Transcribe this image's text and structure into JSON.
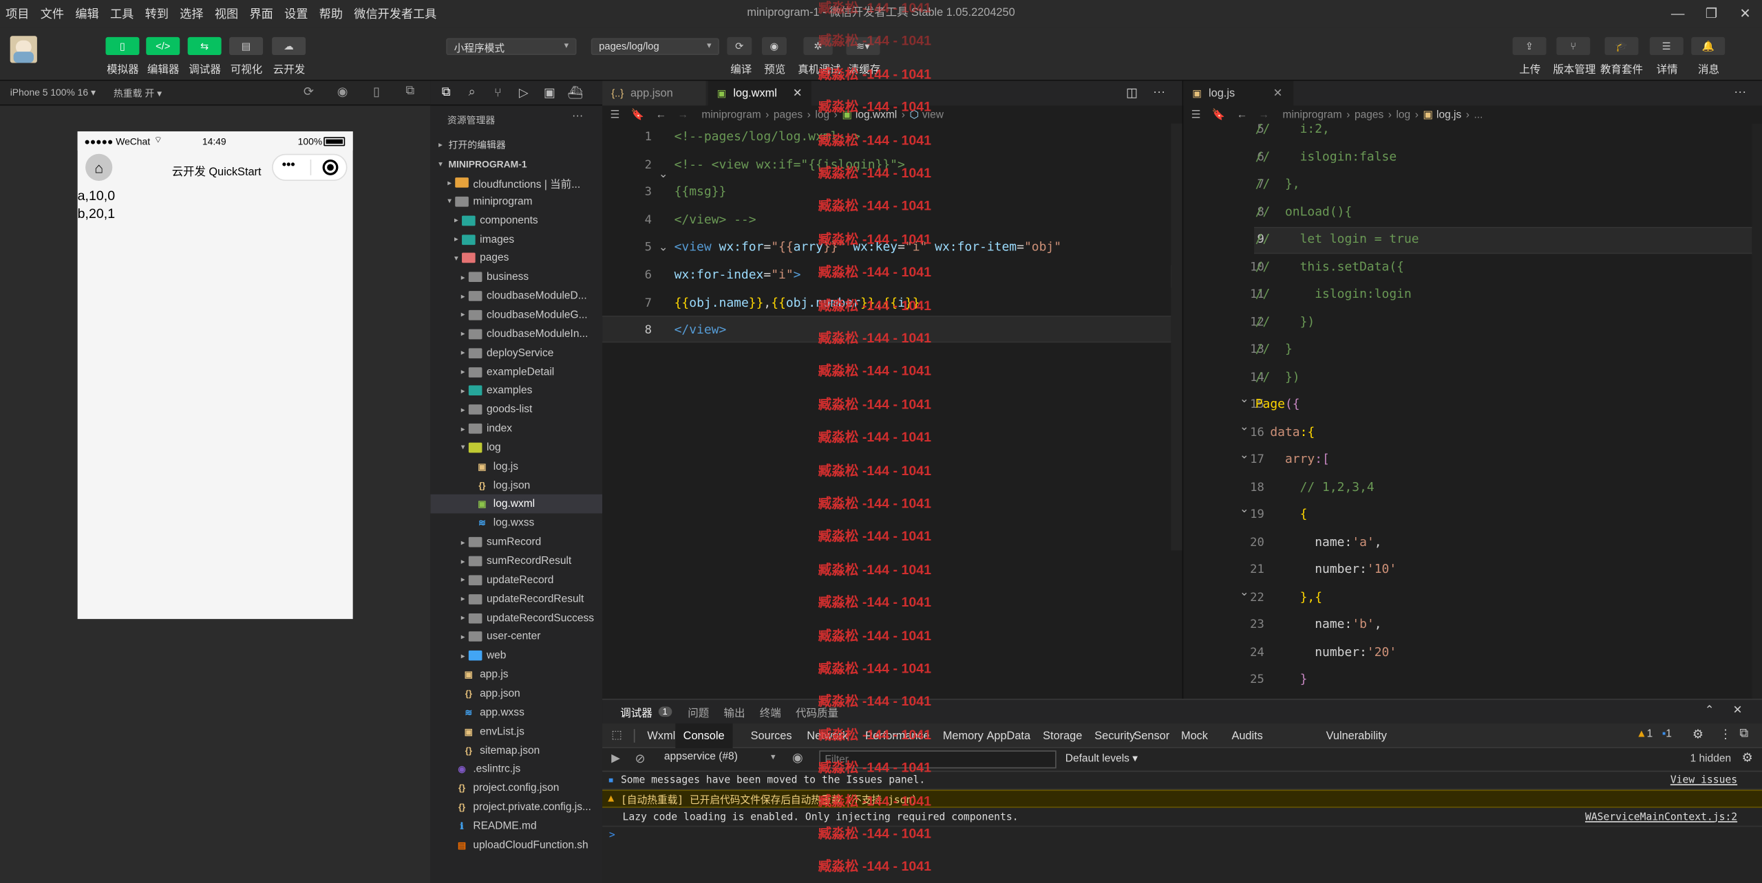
{
  "menu": {
    "items": [
      "项目",
      "文件",
      "编辑",
      "工具",
      "转到",
      "选择",
      "视图",
      "界面",
      "设置",
      "帮助",
      "微信开发者工具"
    ],
    "title": "miniprogram-1 - 微信开发者工具 Stable 1.05.2204250"
  },
  "toolbar": {
    "left_buttons": [
      "模拟器",
      "编辑器",
      "调试器",
      "可视化",
      "云开发"
    ],
    "mode_select": "小程序模式",
    "page_select": "pages/log/log",
    "center_buttons": [
      "编译",
      "预览",
      "真机调试",
      "清缓存"
    ],
    "right_buttons": [
      "上传",
      "版本管理",
      "教育套件",
      "详情",
      "消息"
    ]
  },
  "devicebar": {
    "device": "iPhone 5 100% 16 ▾",
    "hotreload": "热重载 开 ▾"
  },
  "phone": {
    "signal": "●●●●● WeChat",
    "time": "14:49",
    "battery": "100%",
    "nav_title": "云开发 QuickStart",
    "lines": [
      "a,10,0",
      "b,20,1"
    ]
  },
  "explorer": {
    "header": "资源管理器",
    "open_editors": "打开的编辑器",
    "project": "MINIPROGRAM-1",
    "tree": [
      {
        "label": "cloudfunctions | 当前...",
        "depth": 1,
        "kind": "folder-cloud",
        "twisty": "▸"
      },
      {
        "label": "miniprogram",
        "depth": 1,
        "kind": "folder",
        "twisty": "▾"
      },
      {
        "label": "components",
        "depth": 2,
        "kind": "folder-teal",
        "twisty": "▸"
      },
      {
        "label": "images",
        "depth": 2,
        "kind": "folder-teal",
        "twisty": "▸"
      },
      {
        "label": "pages",
        "depth": 2,
        "kind": "folder-red",
        "twisty": "▾"
      },
      {
        "label": "business",
        "depth": 3,
        "kind": "folder",
        "twisty": "▸"
      },
      {
        "label": "cloudbaseModuleD...",
        "depth": 3,
        "kind": "folder",
        "twisty": "▸"
      },
      {
        "label": "cloudbaseModuleG...",
        "depth": 3,
        "kind": "folder",
        "twisty": "▸"
      },
      {
        "label": "cloudbaseModuleIn...",
        "depth": 3,
        "kind": "folder",
        "twisty": "▸"
      },
      {
        "label": "deployService",
        "depth": 3,
        "kind": "folder",
        "twisty": "▸"
      },
      {
        "label": "exampleDetail",
        "depth": 3,
        "kind": "folder",
        "twisty": "▸"
      },
      {
        "label": "examples",
        "depth": 3,
        "kind": "folder-teal",
        "twisty": "▸"
      },
      {
        "label": "goods-list",
        "depth": 3,
        "kind": "folder",
        "twisty": "▸"
      },
      {
        "label": "index",
        "depth": 3,
        "kind": "folder",
        "twisty": "▸"
      },
      {
        "label": "log",
        "depth": 3,
        "kind": "folder-open",
        "twisty": "▾"
      },
      {
        "label": "log.js",
        "depth": 4,
        "kind": "js",
        "twisty": ""
      },
      {
        "label": "log.json",
        "depth": 4,
        "kind": "json",
        "twisty": ""
      },
      {
        "label": "log.wxml",
        "depth": 4,
        "kind": "wxml",
        "twisty": "",
        "selected": true
      },
      {
        "label": "log.wxss",
        "depth": 4,
        "kind": "wxss",
        "twisty": ""
      },
      {
        "label": "sumRecord",
        "depth": 3,
        "kind": "folder",
        "twisty": "▸"
      },
      {
        "label": "sumRecordResult",
        "depth": 3,
        "kind": "folder",
        "twisty": "▸"
      },
      {
        "label": "updateRecord",
        "depth": 3,
        "kind": "folder",
        "twisty": "▸"
      },
      {
        "label": "updateRecordResult",
        "depth": 3,
        "kind": "folder",
        "twisty": "▸"
      },
      {
        "label": "updateRecordSuccess",
        "depth": 3,
        "kind": "folder",
        "twisty": "▸"
      },
      {
        "label": "user-center",
        "depth": 3,
        "kind": "folder",
        "twisty": "▸"
      },
      {
        "label": "web",
        "depth": 3,
        "kind": "folder-blue",
        "twisty": "▸"
      },
      {
        "label": "app.js",
        "depth": 2,
        "kind": "js",
        "twisty": ""
      },
      {
        "label": "app.json",
        "depth": 2,
        "kind": "json",
        "twisty": ""
      },
      {
        "label": "app.wxss",
        "depth": 2,
        "kind": "wxss",
        "twisty": ""
      },
      {
        "label": "envList.js",
        "depth": 2,
        "kind": "js",
        "twisty": ""
      },
      {
        "label": "sitemap.json",
        "depth": 2,
        "kind": "json",
        "twisty": ""
      },
      {
        "label": ".eslintrc.js",
        "depth": 1,
        "kind": "eslint",
        "twisty": ""
      },
      {
        "label": "project.config.json",
        "depth": 1,
        "kind": "json",
        "twisty": ""
      },
      {
        "label": "project.private.config.js...",
        "depth": 1,
        "kind": "json",
        "twisty": ""
      },
      {
        "label": "README.md",
        "depth": 1,
        "kind": "info",
        "twisty": ""
      },
      {
        "label": "uploadCloudFunction.sh",
        "depth": 1,
        "kind": "sh",
        "twisty": ""
      }
    ]
  },
  "editor1": {
    "tabs": [
      "app.json",
      "log.wxml"
    ],
    "breadcrumb": [
      "miniprogram",
      "pages",
      "log",
      "log.wxml",
      "view"
    ],
    "line_numbers": [
      "1",
      "2",
      "3",
      "4",
      "5",
      "6",
      "7",
      "8"
    ],
    "lines": [
      [
        [
          "<!--pages/log/log.wxml-->",
          "cm"
        ]
      ],
      [
        [
          "<!-- <view wx:if=\"{{islogin}}\"> ",
          "cm"
        ]
      ],
      [
        [
          "{{msg}}",
          "cm"
        ]
      ],
      [
        [
          "</view> -->",
          "cm"
        ]
      ],
      [
        [
          "<view ",
          "tg"
        ],
        [
          "wx:for",
          "at"
        ],
        [
          "=",
          "pl"
        ],
        [
          "\"{{",
          "st"
        ],
        [
          "arry",
          "vr"
        ],
        [
          "}}\"",
          "st"
        ],
        [
          " wx:key",
          "at"
        ],
        [
          "=",
          "pl"
        ],
        [
          "\"i\"",
          "st"
        ],
        [
          " wx:for-item",
          "at"
        ],
        [
          "=",
          "pl"
        ],
        [
          "\"obj\"",
          "st"
        ]
      ],
      [
        [
          "wx:for-index",
          "at"
        ],
        [
          "=",
          "pl"
        ],
        [
          "\"i\"",
          "st"
        ],
        [
          ">",
          "tg"
        ]
      ],
      [
        [
          "{{",
          "br"
        ],
        [
          "obj.name",
          "vr"
        ],
        [
          "}}",
          "br"
        ],
        [
          ",",
          "pl"
        ],
        [
          "{{",
          "br"
        ],
        [
          "obj.number",
          "vr"
        ],
        [
          "}}",
          "br"
        ],
        [
          ",",
          "pl"
        ],
        [
          "{{",
          "br"
        ],
        [
          "i",
          "vr"
        ],
        [
          "}}",
          "br"
        ]
      ],
      [
        [
          "</view>",
          "tg"
        ]
      ]
    ]
  },
  "editor2": {
    "tab": "log.js",
    "breadcrumb": [
      "miniprogram",
      "pages",
      "log",
      "log.js",
      "..."
    ],
    "line_numbers": [
      "5",
      "6",
      "7",
      "8",
      "9",
      "10",
      "11",
      "12",
      "13",
      "14",
      "15",
      "16",
      "17",
      "18",
      "19",
      "20",
      "21",
      "22",
      "23",
      "24",
      "25"
    ],
    "lines": [
      [
        [
          "//    i:2,",
          "cm"
        ]
      ],
      [
        [
          "//    islogin:false",
          "cm"
        ]
      ],
      [
        [
          "//  },",
          "cm"
        ]
      ],
      [
        [
          "//  onLoad(){",
          "cm"
        ]
      ],
      [
        [
          "//    let login = true",
          "cm"
        ]
      ],
      [
        [
          "//    this.setData({",
          "cm"
        ]
      ],
      [
        [
          "//      islogin:login",
          "cm"
        ]
      ],
      [
        [
          "//    })",
          "cm"
        ]
      ],
      [
        [
          "//  }",
          "cm"
        ]
      ],
      [
        [
          "//  })",
          "cm"
        ]
      ],
      [
        [
          "Page",
          "br"
        ],
        [
          "({",
          "kw"
        ]
      ],
      [
        [
          "  data",
          "s2"
        ],
        [
          ":{",
          "br"
        ]
      ],
      [
        [
          "    arry",
          "s2"
        ],
        [
          ":[",
          "kw"
        ]
      ],
      [
        [
          "      // 1,2,3,4",
          "cm"
        ]
      ],
      [
        [
          "      {",
          "br"
        ]
      ],
      [
        [
          "        name",
          "pl"
        ],
        [
          ":",
          "pl"
        ],
        [
          "'a'",
          "s2"
        ],
        [
          ",",
          "pl"
        ]
      ],
      [
        [
          "        number",
          "pl"
        ],
        [
          ":",
          "pl"
        ],
        [
          "'10'",
          "s2"
        ]
      ],
      [
        [
          "      },{",
          "br"
        ]
      ],
      [
        [
          "        name",
          "pl"
        ],
        [
          ":",
          "pl"
        ],
        [
          "'b'",
          "s2"
        ],
        [
          ",",
          "pl"
        ]
      ],
      [
        [
          "        number",
          "pl"
        ],
        [
          ":",
          "pl"
        ],
        [
          "'20'",
          "s2"
        ]
      ],
      [
        [
          "      }",
          "kw"
        ]
      ]
    ]
  },
  "debugger": {
    "tabs": [
      "调试器",
      "问题",
      "输出",
      "终端",
      "代码质量"
    ],
    "badge": "1",
    "panels": [
      "Wxml",
      "Console",
      "Sources",
      "Network",
      "Performance",
      "Memory",
      "AppData",
      "Storage",
      "Security",
      "Sensor",
      "Mock",
      "Audits",
      "Vulnerability"
    ],
    "warn_count": "1",
    "info_count": "1",
    "context": "appservice (#8)",
    "filter_placeholder": "Filter",
    "levels": "Default levels ▾",
    "hidden": "1 hidden",
    "messages": [
      {
        "text": "Some messages have been moved to the Issues panel.",
        "link": "View issues",
        "kind": "info"
      },
      {
        "text": "[自动热重载] 已开启代码文件保存后自动热重载（不支持 json）",
        "link": "",
        "kind": "warn"
      },
      {
        "text": "Lazy code loading is enabled. Only injecting required components.",
        "link": "WAServiceMainContext.js:2",
        "kind": "log"
      }
    ],
    "prompt": ">"
  },
  "watermark": "臧淼松 -144 - 1041",
  "colors": {
    "green": "#07c160",
    "accent": "#0e639c",
    "warning": "#e5a00d"
  }
}
